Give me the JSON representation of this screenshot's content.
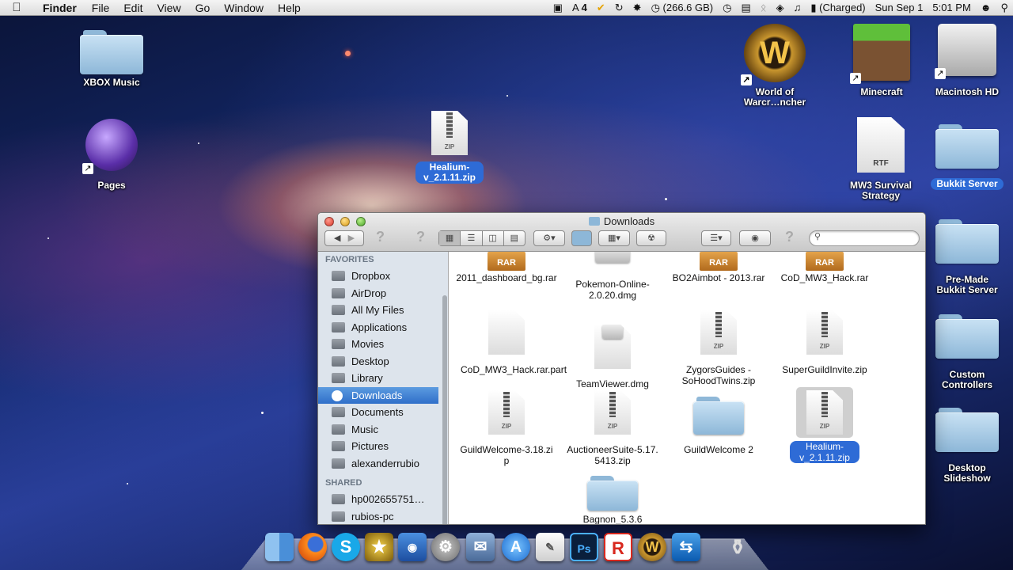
{
  "menubar": {
    "app_name": "Finder",
    "menus": [
      "File",
      "Edit",
      "View",
      "Go",
      "Window",
      "Help"
    ],
    "status": {
      "adobe_count": "4",
      "disk_space": "(266.6 GB)",
      "battery": "(Charged)",
      "date": "Sun Sep 1",
      "time": "5:01 PM"
    },
    "icons": [
      "apple-icon",
      "facetime-camera-icon",
      "adobe-icon",
      "checkmark-icon",
      "sync-icon",
      "time-machine-icon",
      "display-icon",
      "bluetooth-icon",
      "wifi-icon",
      "volume-icon",
      "battery-icon",
      "user-icon",
      "spotlight-icon"
    ]
  },
  "desktop": {
    "icons": [
      {
        "label": "XBOX Music",
        "kind": "folder"
      },
      {
        "label": "Pages",
        "kind": "app"
      },
      {
        "label": "Healium-v_2.1.11.zip",
        "kind": "zip",
        "selected": true
      },
      {
        "label": "World of Warcr…ncher",
        "kind": "app"
      },
      {
        "label": "Minecraft",
        "kind": "app"
      },
      {
        "label": "Macintosh HD",
        "kind": "disk"
      },
      {
        "label": "MW3 Survival Strategy",
        "kind": "rtf"
      },
      {
        "label": "Bukkit Server",
        "kind": "folder",
        "selected": true
      },
      {
        "label": "Pre-Made Bukkit Server",
        "kind": "folder"
      },
      {
        "label": "Custom Controllers",
        "kind": "folder"
      },
      {
        "label": "Desktop Slideshow",
        "kind": "folder"
      }
    ]
  },
  "finder": {
    "title": "Downloads",
    "sidebar": {
      "favorites_header": "FAVORITES",
      "favorites": [
        "Dropbox",
        "AirDrop",
        "All My Files",
        "Applications",
        "Movies",
        "Desktop",
        "Library",
        "Downloads",
        "Documents",
        "Music",
        "Pictures",
        "alexanderrubio"
      ],
      "active": "Downloads",
      "shared_header": "SHARED",
      "shared": [
        "hp002655751…",
        "rubios-pc"
      ]
    },
    "files": [
      {
        "name": "2011_dashboard_bg.rar",
        "kind": "rar"
      },
      {
        "name": "Pokemon-Online-2.0.20.dmg",
        "kind": "dmg"
      },
      {
        "name": "BO2Aimbot - 2013.rar",
        "kind": "rar"
      },
      {
        "name": "CoD_MW3_Hack.rar",
        "kind": "rar"
      },
      {
        "name": "CoD_MW3_Hack.rar.part",
        "kind": "doc"
      },
      {
        "name": "TeamViewer.dmg",
        "kind": "dmg"
      },
      {
        "name": "ZygorsGuides - SoHoodTwins.zip",
        "kind": "zip"
      },
      {
        "name": "SuperGuildInvite.zip",
        "kind": "zip"
      },
      {
        "name": "GuildWelcome-3.18.zip",
        "kind": "zip"
      },
      {
        "name": "AuctioneerSuite-5.17.5413.zip",
        "kind": "zip"
      },
      {
        "name": "GuildWelcome 2",
        "kind": "folder"
      },
      {
        "name": "Healium-v_2.1.11.zip",
        "kind": "zip",
        "selected": true
      },
      {
        "name": "Bagnon_5.3.6",
        "kind": "folder"
      }
    ],
    "tags": {
      "rar": "RAR",
      "zip": "ZIP",
      "rtf": "RTF"
    }
  },
  "dock": {
    "apps": [
      "Finder",
      "Firefox",
      "Skype",
      "iMovie",
      "Preview",
      "System Preferences",
      "Mail",
      "App Store",
      "TextEdit",
      "Photoshop",
      "Roblox",
      "World of Warcraft",
      "TeamViewer",
      "Trash"
    ],
    "labels": {
      "Photoshop": "Ps",
      "Roblox": "R"
    }
  },
  "colors": {
    "selection": "#2e6bd6",
    "sidebar_bg": "#dde4ec"
  }
}
